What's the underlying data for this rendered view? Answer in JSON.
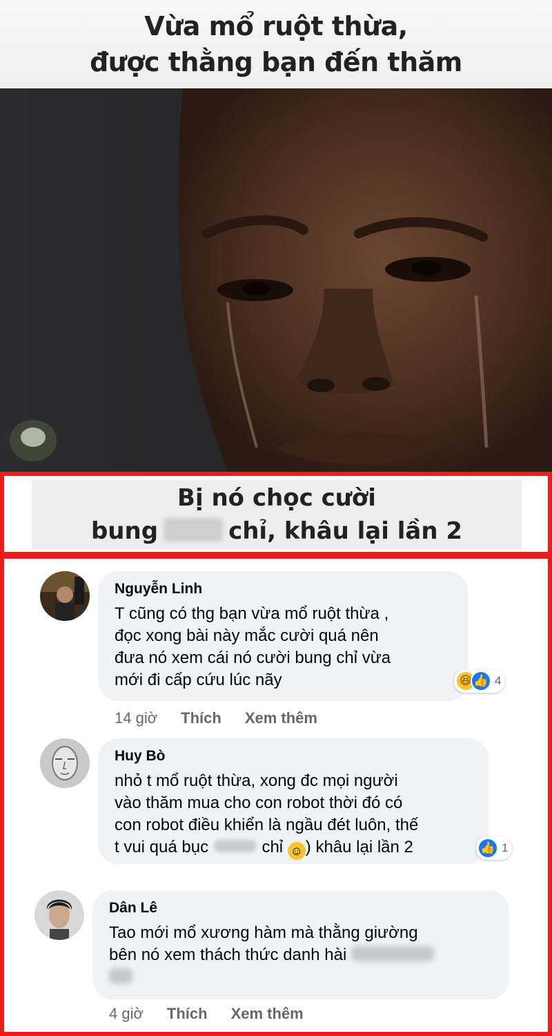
{
  "meme": {
    "top_caption": [
      "Vừa mổ ruột thừa,",
      "được thằng bạn đến thăm"
    ],
    "bottom_caption": {
      "line1": "Bị nó chọc cười",
      "line2_start": "bung",
      "line2_end": "chỉ, khâu lại lần 2"
    }
  },
  "comments": [
    {
      "author": "Nguyễn Linh",
      "lines": [
        "T cũng có thg bạn vừa mổ ruột thừa ,",
        "đọc xong bài này mắc cười quá nên",
        "đưa nó xem cái nó cười bung chỉ vừa",
        "mới đi cấp cứu lúc nãy"
      ],
      "reaction_count": "4",
      "reaction_icons": [
        "haha-icon",
        "like-icon"
      ],
      "time": "14 giờ",
      "like_label": "Thích",
      "more_label": "Xem thêm"
    },
    {
      "author": "Huy Bò",
      "lines": [
        "nhỏ t mổ ruột thừa, xong đc mọi người",
        "vào thăm mua cho con robot thời đó có",
        "con robot điều khiển là ngầu đét luôn, thế"
      ],
      "last_line_start": "t vui quá bục",
      "last_line_mid": "chỉ",
      "last_line_end": ") khâu lại lần 2",
      "reaction_count": "1",
      "reaction_icons": [
        "like-icon"
      ]
    },
    {
      "author": "Dân Lê",
      "lines": [
        "Tao mới mổ xương hàm mà thằng giường"
      ],
      "line2_start": "bên nó xem thách thức danh hài",
      "time": "4 giờ",
      "like_label": "Thích",
      "more_label": "Xem thêm"
    }
  ],
  "colors": {
    "highlight_frame": "#ec1c1c",
    "bubble_bg": "#f0f2f5",
    "meta_text": "#65676b",
    "like_blue": "#1877f2"
  }
}
